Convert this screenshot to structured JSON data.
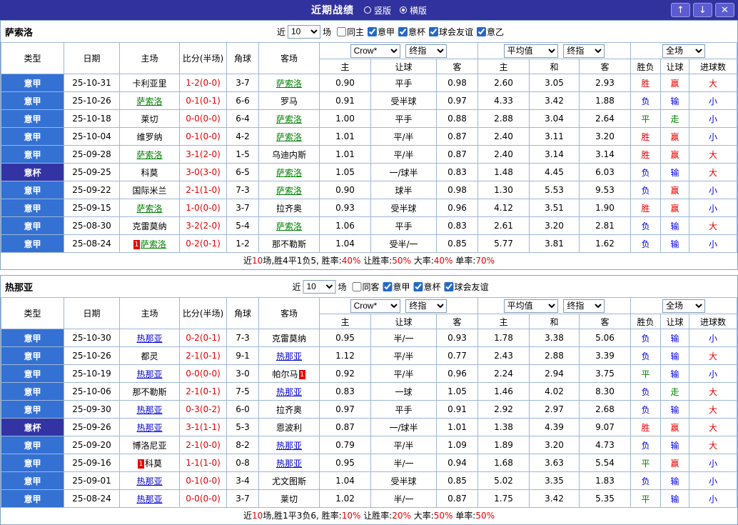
{
  "colors": {
    "red": "#e60000",
    "blue": "#0000e0",
    "green": "#008000",
    "league_bg": "#3471d3",
    "cup_bg": "#3333a3",
    "titlebar_bg": "#32329e"
  },
  "titlebar": {
    "title": "近期战绩",
    "radios": [
      {
        "label": "竖版",
        "checked": false
      },
      {
        "label": "横版",
        "checked": true
      }
    ],
    "up_icon": "↑",
    "down_icon": "↓",
    "close_icon": "✕"
  },
  "header_labels": {
    "statics": [
      "类型",
      "日期",
      "主场",
      "比分(半场)",
      "角球",
      "客场"
    ],
    "company_dd": "Crow*",
    "final_dd1": "终指",
    "avg_dd": "平均值",
    "final_dd2": "终指",
    "full_dd": "全场",
    "sub": [
      "主",
      "让球",
      "客",
      "主",
      "和",
      "客",
      "胜负",
      "让球",
      "进球数"
    ]
  },
  "sections": [
    {
      "team": "萨索洛",
      "team_color": "#008000",
      "filter": {
        "near": "近",
        "count": "10",
        "unit": "场",
        "checks": [
          {
            "label": "同主",
            "checked": false
          },
          {
            "label": "意甲",
            "checked": true
          },
          {
            "label": "意杯",
            "checked": true
          },
          {
            "label": "球会友谊",
            "checked": true
          },
          {
            "label": "意乙",
            "checked": true
          }
        ]
      },
      "rows": [
        {
          "lg": "意甲",
          "cup": false,
          "date": "25-10-31",
          "home": "卡利亚里",
          "hT": false,
          "hRC": "",
          "score": "1-2(0-0)",
          "cor": "3-7",
          "away": "萨索洛",
          "aT": true,
          "aRC": "",
          "od": [
            "0.90",
            "平手",
            "0.98"
          ],
          "av": [
            "2.60",
            "3.05",
            "2.93"
          ],
          "res": [
            [
              "胜",
              "r"
            ],
            [
              "赢",
              "r"
            ],
            [
              "大",
              "r"
            ]
          ]
        },
        {
          "lg": "意甲",
          "cup": false,
          "date": "25-10-26",
          "home": "萨索洛",
          "hT": true,
          "hRC": "",
          "score": "0-1(0-1)",
          "cor": "6-6",
          "away": "罗马",
          "aT": false,
          "aRC": "",
          "od": [
            "0.91",
            "受半球",
            "0.97"
          ],
          "av": [
            "4.33",
            "3.42",
            "1.88"
          ],
          "res": [
            [
              "负",
              "b"
            ],
            [
              "输",
              "b"
            ],
            [
              "小",
              "b"
            ]
          ]
        },
        {
          "lg": "意甲",
          "cup": false,
          "date": "25-10-18",
          "home": "莱切",
          "hT": false,
          "hRC": "",
          "score": "0-0(0-0)",
          "cor": "6-4",
          "away": "萨索洛",
          "aT": true,
          "aRC": "",
          "od": [
            "1.00",
            "平手",
            "0.88"
          ],
          "av": [
            "2.88",
            "3.04",
            "2.64"
          ],
          "res": [
            [
              "平",
              "g"
            ],
            [
              "走",
              "g"
            ],
            [
              "小",
              "b"
            ]
          ]
        },
        {
          "lg": "意甲",
          "cup": false,
          "date": "25-10-04",
          "home": "维罗纳",
          "hT": false,
          "hRC": "",
          "score": "0-1(0-0)",
          "cor": "4-2",
          "away": "萨索洛",
          "aT": true,
          "aRC": "",
          "od": [
            "1.01",
            "平/半",
            "0.87"
          ],
          "av": [
            "2.40",
            "3.11",
            "3.20"
          ],
          "res": [
            [
              "胜",
              "r"
            ],
            [
              "赢",
              "r"
            ],
            [
              "小",
              "b"
            ]
          ]
        },
        {
          "lg": "意甲",
          "cup": false,
          "date": "25-09-28",
          "home": "萨索洛",
          "hT": true,
          "hRC": "",
          "score": "3-1(2-0)",
          "cor": "1-5",
          "away": "乌迪内斯",
          "aT": false,
          "aRC": "",
          "od": [
            "1.01",
            "平/半",
            "0.87"
          ],
          "av": [
            "2.40",
            "3.14",
            "3.14"
          ],
          "res": [
            [
              "胜",
              "r"
            ],
            [
              "赢",
              "r"
            ],
            [
              "大",
              "r"
            ]
          ]
        },
        {
          "lg": "意杯",
          "cup": true,
          "date": "25-09-25",
          "home": "科莫",
          "hT": false,
          "hRC": "",
          "score": "3-0(3-0)",
          "cor": "6-5",
          "away": "萨索洛",
          "aT": true,
          "aRC": "",
          "od": [
            "1.05",
            "一/球半",
            "0.83"
          ],
          "av": [
            "1.48",
            "4.45",
            "6.03"
          ],
          "res": [
            [
              "负",
              "b"
            ],
            [
              "输",
              "b"
            ],
            [
              "大",
              "r"
            ]
          ]
        },
        {
          "lg": "意甲",
          "cup": false,
          "date": "25-09-22",
          "home": "国际米兰",
          "hT": false,
          "hRC": "",
          "score": "2-1(1-0)",
          "cor": "7-3",
          "away": "萨索洛",
          "aT": true,
          "aRC": "",
          "od": [
            "0.90",
            "球半",
            "0.98"
          ],
          "av": [
            "1.30",
            "5.53",
            "9.53"
          ],
          "res": [
            [
              "负",
              "b"
            ],
            [
              "赢",
              "r"
            ],
            [
              "小",
              "b"
            ]
          ]
        },
        {
          "lg": "意甲",
          "cup": false,
          "date": "25-09-15",
          "home": "萨索洛",
          "hT": true,
          "hRC": "",
          "score": "1-0(0-0)",
          "cor": "3-7",
          "away": "拉齐奥",
          "aT": false,
          "aRC": "",
          "od": [
            "0.93",
            "受半球",
            "0.96"
          ],
          "av": [
            "4.12",
            "3.51",
            "1.90"
          ],
          "res": [
            [
              "胜",
              "r"
            ],
            [
              "赢",
              "r"
            ],
            [
              "小",
              "b"
            ]
          ]
        },
        {
          "lg": "意甲",
          "cup": false,
          "date": "25-08-30",
          "home": "克雷莫纳",
          "hT": false,
          "hRC": "",
          "score": "3-2(2-0)",
          "cor": "5-4",
          "away": "萨索洛",
          "aT": true,
          "aRC": "",
          "od": [
            "1.06",
            "平手",
            "0.83"
          ],
          "av": [
            "2.61",
            "3.20",
            "2.81"
          ],
          "res": [
            [
              "负",
              "b"
            ],
            [
              "输",
              "b"
            ],
            [
              "大",
              "r"
            ]
          ]
        },
        {
          "lg": "意甲",
          "cup": false,
          "date": "25-08-24",
          "home": "萨索洛",
          "hT": true,
          "hRC": "1",
          "score": "0-2(0-1)",
          "cor": "1-2",
          "away": "那不勒斯",
          "aT": false,
          "aRC": "",
          "od": [
            "1.04",
            "受半/一",
            "0.85"
          ],
          "av": [
            "5.77",
            "3.81",
            "1.62"
          ],
          "res": [
            [
              "负",
              "b"
            ],
            [
              "输",
              "b"
            ],
            [
              "小",
              "b"
            ]
          ]
        }
      ],
      "summary": [
        [
          "近",
          false
        ],
        [
          "10",
          true
        ],
        [
          "场,胜4平1负5, 胜率:",
          false
        ],
        [
          "40%",
          true
        ],
        [
          " 让胜率:",
          false
        ],
        [
          "50%",
          true
        ],
        [
          " 大率:",
          false
        ],
        [
          "40%",
          true
        ],
        [
          " 单率:",
          false
        ],
        [
          "70%",
          true
        ]
      ]
    },
    {
      "team": "热那亚",
      "team_color": "#0000cc",
      "filter": {
        "near": "近",
        "count": "10",
        "unit": "场",
        "checks": [
          {
            "label": "同客",
            "checked": false
          },
          {
            "label": "意甲",
            "checked": true
          },
          {
            "label": "意杯",
            "checked": true
          },
          {
            "label": "球会友谊",
            "checked": true
          }
        ]
      },
      "rows": [
        {
          "lg": "意甲",
          "cup": false,
          "date": "25-10-30",
          "home": "热那亚",
          "hT": true,
          "hRC": "",
          "score": "0-2(0-1)",
          "cor": "7-3",
          "away": "克雷莫纳",
          "aT": false,
          "aRC": "",
          "od": [
            "0.95",
            "半/一",
            "0.93"
          ],
          "av": [
            "1.78",
            "3.38",
            "5.06"
          ],
          "res": [
            [
              "负",
              "b"
            ],
            [
              "输",
              "b"
            ],
            [
              "小",
              "b"
            ]
          ]
        },
        {
          "lg": "意甲",
          "cup": false,
          "date": "25-10-26",
          "home": "都灵",
          "hT": false,
          "hRC": "",
          "score": "2-1(0-1)",
          "cor": "9-1",
          "away": "热那亚",
          "aT": true,
          "aRC": "",
          "od": [
            "1.12",
            "平/半",
            "0.77"
          ],
          "av": [
            "2.43",
            "2.88",
            "3.39"
          ],
          "res": [
            [
              "负",
              "b"
            ],
            [
              "输",
              "b"
            ],
            [
              "大",
              "r"
            ]
          ]
        },
        {
          "lg": "意甲",
          "cup": false,
          "date": "25-10-19",
          "home": "热那亚",
          "hT": true,
          "hRC": "",
          "score": "0-0(0-0)",
          "cor": "3-0",
          "away": "帕尔马",
          "aT": false,
          "aRC": "1",
          "od": [
            "0.92",
            "平/半",
            "0.96"
          ],
          "av": [
            "2.24",
            "2.94",
            "3.75"
          ],
          "res": [
            [
              "平",
              "g"
            ],
            [
              "输",
              "b"
            ],
            [
              "小",
              "b"
            ]
          ]
        },
        {
          "lg": "意甲",
          "cup": false,
          "date": "25-10-06",
          "home": "那不勒斯",
          "hT": false,
          "hRC": "",
          "score": "2-1(0-1)",
          "cor": "7-5",
          "away": "热那亚",
          "aT": true,
          "aRC": "",
          "od": [
            "0.83",
            "一球",
            "1.05"
          ],
          "av": [
            "1.46",
            "4.02",
            "8.30"
          ],
          "res": [
            [
              "负",
              "b"
            ],
            [
              "走",
              "g"
            ],
            [
              "大",
              "r"
            ]
          ]
        },
        {
          "lg": "意甲",
          "cup": false,
          "date": "25-09-30",
          "home": "热那亚",
          "hT": true,
          "hRC": "",
          "score": "0-3(0-2)",
          "cor": "6-0",
          "away": "拉齐奥",
          "aT": false,
          "aRC": "",
          "od": [
            "0.97",
            "平手",
            "0.91"
          ],
          "av": [
            "2.92",
            "2.97",
            "2.68"
          ],
          "res": [
            [
              "负",
              "b"
            ],
            [
              "输",
              "b"
            ],
            [
              "大",
              "r"
            ]
          ]
        },
        {
          "lg": "意杯",
          "cup": true,
          "date": "25-09-26",
          "home": "热那亚",
          "hT": true,
          "hRC": "",
          "score": "3-1(1-1)",
          "cor": "5-3",
          "away": "恩波利",
          "aT": false,
          "aRC": "",
          "od": [
            "0.87",
            "一/球半",
            "1.01"
          ],
          "av": [
            "1.38",
            "4.39",
            "9.07"
          ],
          "res": [
            [
              "胜",
              "r"
            ],
            [
              "赢",
              "r"
            ],
            [
              "大",
              "r"
            ]
          ]
        },
        {
          "lg": "意甲",
          "cup": false,
          "date": "25-09-20",
          "home": "博洛尼亚",
          "hT": false,
          "hRC": "",
          "score": "2-1(0-0)",
          "cor": "8-2",
          "away": "热那亚",
          "aT": true,
          "aRC": "",
          "od": [
            "0.79",
            "平/半",
            "1.09"
          ],
          "av": [
            "1.89",
            "3.20",
            "4.73"
          ],
          "res": [
            [
              "负",
              "b"
            ],
            [
              "输",
              "b"
            ],
            [
              "大",
              "r"
            ]
          ]
        },
        {
          "lg": "意甲",
          "cup": false,
          "date": "25-09-16",
          "home": "科莫",
          "hT": false,
          "hRC": "1",
          "score": "1-1(1-0)",
          "cor": "0-8",
          "away": "热那亚",
          "aT": true,
          "aRC": "",
          "od": [
            "0.95",
            "半/一",
            "0.94"
          ],
          "av": [
            "1.68",
            "3.63",
            "5.54"
          ],
          "res": [
            [
              "平",
              "g"
            ],
            [
              "赢",
              "r"
            ],
            [
              "小",
              "b"
            ]
          ]
        },
        {
          "lg": "意甲",
          "cup": false,
          "date": "25-09-01",
          "home": "热那亚",
          "hT": true,
          "hRC": "",
          "score": "0-1(0-0)",
          "cor": "3-4",
          "away": "尤文图斯",
          "aT": false,
          "aRC": "",
          "od": [
            "1.04",
            "受半球",
            "0.85"
          ],
          "av": [
            "5.02",
            "3.35",
            "1.83"
          ],
          "res": [
            [
              "负",
              "b"
            ],
            [
              "输",
              "b"
            ],
            [
              "小",
              "b"
            ]
          ]
        },
        {
          "lg": "意甲",
          "cup": false,
          "date": "25-08-24",
          "home": "热那亚",
          "hT": true,
          "hRC": "",
          "score": "0-0(0-0)",
          "cor": "3-7",
          "away": "莱切",
          "aT": false,
          "aRC": "",
          "od": [
            "1.02",
            "半/一",
            "0.87"
          ],
          "av": [
            "1.75",
            "3.42",
            "5.35"
          ],
          "res": [
            [
              "平",
              "g"
            ],
            [
              "输",
              "b"
            ],
            [
              "小",
              "b"
            ]
          ]
        }
      ],
      "summary": [
        [
          "近",
          false
        ],
        [
          "10",
          true
        ],
        [
          "场,胜1平3负6, 胜率:",
          false
        ],
        [
          "10%",
          true
        ],
        [
          " 让胜率:",
          false
        ],
        [
          "20%",
          true
        ],
        [
          " 大率:",
          false
        ],
        [
          "50%",
          true
        ],
        [
          " 单率:",
          false
        ],
        [
          "50%",
          true
        ]
      ]
    }
  ]
}
